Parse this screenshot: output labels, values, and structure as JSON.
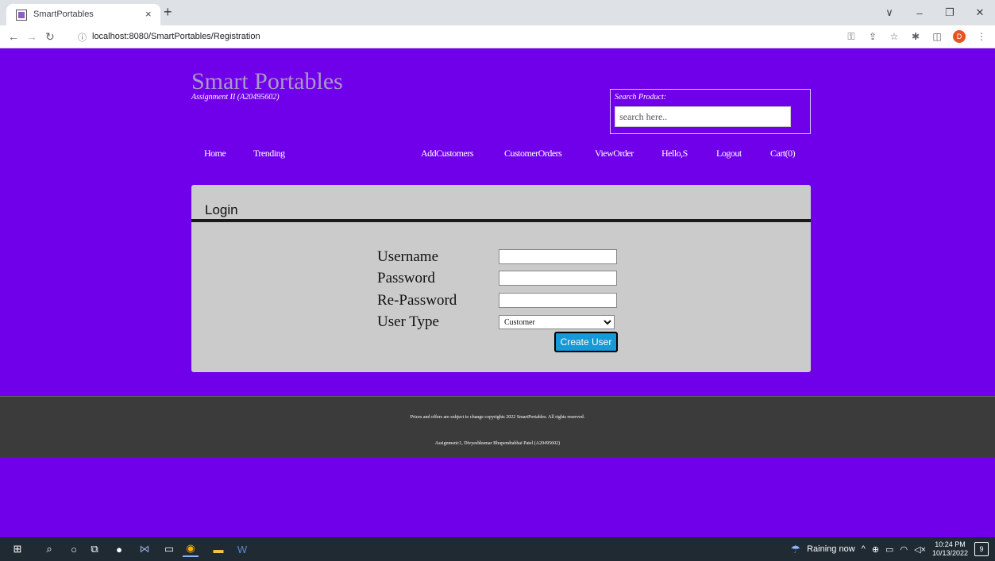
{
  "browser": {
    "tab_title": "SmartPortables",
    "tab_close": "×",
    "new_tab": "+",
    "url_info_icon": "ⓘ",
    "url": "localhost:8080/SmartPortables/Registration",
    "profile_initial": "D",
    "window_controls": [
      "∨",
      "–",
      "❐",
      "✕"
    ]
  },
  "header": {
    "brand": "Smart Portables",
    "subtitle": "Assignment II (A20495602)",
    "search_label": "Search Product:",
    "search_placeholder": "search here.."
  },
  "nav": {
    "home": "Home",
    "trending": "Trending",
    "add_customers": "AddCustomers",
    "customer_orders": "CustomerOrders",
    "view_order": "ViewOrder",
    "hello": "Hello,S",
    "logout": "Logout",
    "cart": "Cart(0)"
  },
  "form": {
    "title": "Login",
    "username_label": "Username",
    "password_label": "Password",
    "repassword_label": "Re-Password",
    "usertype_label": "User Type",
    "usertype_selected": "Customer",
    "submit_label": "Create User"
  },
  "footer": {
    "line1": "Prices and offers are subject to change copyrights 2022 SmartPortables. All rights reserved.",
    "line2": "Assignment:1, Divyeshkumar Bhupendrabhai Patel (A20495602)"
  },
  "taskbar": {
    "weather": "Raining now",
    "time": "10:24 PM",
    "date": "10/13/2022",
    "notifications": "9"
  }
}
